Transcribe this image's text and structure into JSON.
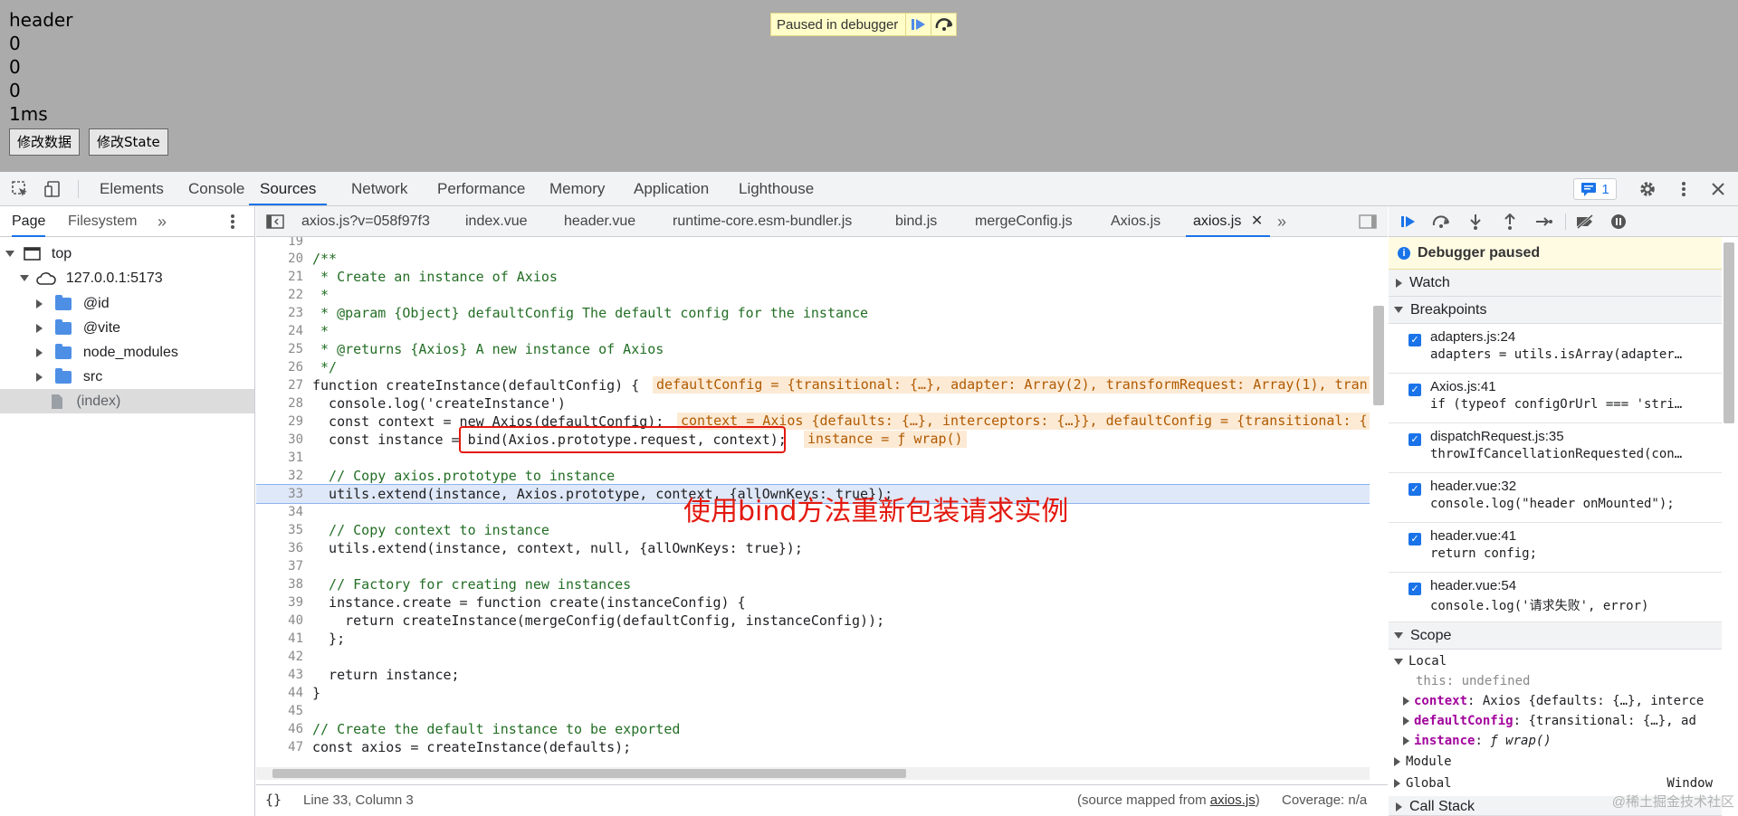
{
  "app": {
    "lines": [
      "header",
      "0",
      "0",
      "0",
      "1ms"
    ],
    "buttons": [
      "修改数据",
      "修改State"
    ]
  },
  "paused_banner": {
    "label": "Paused in debugger"
  },
  "devtools": {
    "main_tabs": [
      "Elements",
      "Console",
      "Sources",
      "Network",
      "Performance",
      "Memory",
      "Application",
      "Lighthouse"
    ],
    "active_tab": "Sources",
    "issues_count": "1",
    "navigator_tabs": [
      "Page",
      "Filesystem"
    ],
    "tree": [
      {
        "label": "top"
      },
      {
        "label": "127.0.0.1:5173"
      },
      {
        "label": "@id"
      },
      {
        "label": "@vite"
      },
      {
        "label": "node_modules"
      },
      {
        "label": "src"
      },
      {
        "label": "(index)"
      }
    ],
    "file_tabs": [
      "axios.js?v=058f97f3",
      "index.vue",
      "header.vue",
      "runtime-core.esm-bundler.js",
      "bind.js",
      "mergeConfig.js",
      "Axios.js",
      "axios.js"
    ],
    "status": {
      "position": "Line 33, Column 3",
      "source_prefix": "(source mapped from ",
      "source_link": "axios.js",
      "source_suffix": ")",
      "coverage": "Coverage: n/a"
    },
    "code_lines": [
      {
        "n": "19",
        "t": ""
      },
      {
        "n": "20",
        "t": "/**"
      },
      {
        "n": "21",
        "t": " * Create an instance of Axios"
      },
      {
        "n": "22",
        "t": " *"
      },
      {
        "n": "23",
        "t": " * @param {Object} defaultConfig The default config for the instance"
      },
      {
        "n": "24",
        "t": " *"
      },
      {
        "n": "25",
        "t": " * @returns {Axios} A new instance of Axios"
      },
      {
        "n": "26",
        "t": " */"
      },
      {
        "n": "27",
        "t": "function createInstance(defaultConfig) {"
      },
      {
        "n": "28",
        "t": "  console.log('createInstance')"
      },
      {
        "n": "29",
        "t": "  const context = new Axios(defaultConfig);"
      },
      {
        "n": "30",
        "t": "  const instance = bind(Axios.prototype.request, context);"
      },
      {
        "n": "31",
        "t": ""
      },
      {
        "n": "32",
        "t": "  // Copy axios.prototype to instance"
      },
      {
        "n": "33",
        "t": "  utils.extend(instance, Axios.prototype, context, {allOwnKeys: true});"
      },
      {
        "n": "34",
        "t": ""
      },
      {
        "n": "35",
        "t": "  // Copy context to instance"
      },
      {
        "n": "36",
        "t": "  utils.extend(instance, context, null, {allOwnKeys: true});"
      },
      {
        "n": "37",
        "t": ""
      },
      {
        "n": "38",
        "t": "  // Factory for creating new instances"
      },
      {
        "n": "39",
        "t": "  instance.create = function create(instanceConfig) {"
      },
      {
        "n": "40",
        "t": "    return createInstance(mergeConfig(defaultConfig, instanceConfig));"
      },
      {
        "n": "41",
        "t": "  };"
      },
      {
        "n": "42",
        "t": ""
      },
      {
        "n": "43",
        "t": "  return instance;"
      },
      {
        "n": "44",
        "t": "}"
      },
      {
        "n": "45",
        "t": ""
      },
      {
        "n": "46",
        "t": "// Create the default instance to be exported"
      },
      {
        "n": "47",
        "t": "const axios = createInstance(defaults);"
      }
    ],
    "annotations": {
      "a27": "defaultConfig = {transitional: {…}, adapter: Array(2), transformRequest: Array(1), tran",
      "a29": "context = Axios {defaults: {…}, interceptors: {…}}, defaultConfig = {transitional: {",
      "a30": "instance = ƒ wrap()"
    },
    "overlay_note": "使用bind方法重新包装请求实例",
    "right": {
      "debugger_paused": "Debugger paused",
      "watch": "Watch",
      "breakpoints": "Breakpoints",
      "bps": [
        {
          "file": "adapters.js:24",
          "code": "adapters = utils.isArray(adapter…"
        },
        {
          "file": "Axios.js:41",
          "code": "if (typeof configOrUrl === 'stri…"
        },
        {
          "file": "dispatchRequest.js:35",
          "code": "throwIfCancellationRequested(con…"
        },
        {
          "file": "header.vue:32",
          "code": "console.log(\"header onMounted\");"
        },
        {
          "file": "header.vue:41",
          "code": "return config;"
        },
        {
          "file": "header.vue:54",
          "code": "console.log('请求失败', error)"
        }
      ],
      "scope": "Scope",
      "local": "Local",
      "this_key": "this",
      "this_val": "undefined",
      "vars": [
        {
          "k": "context",
          "v": "Axios {defaults: {…}, interce"
        },
        {
          "k": "defaultConfig",
          "v": "{transitional: {…}, ad"
        },
        {
          "k": "instance",
          "v": "ƒ wrap()"
        }
      ],
      "module": "Module",
      "global": "Global",
      "global_val": "Window",
      "call_stack": "Call Stack"
    },
    "watermark": "@稀土掘金技术社区"
  }
}
